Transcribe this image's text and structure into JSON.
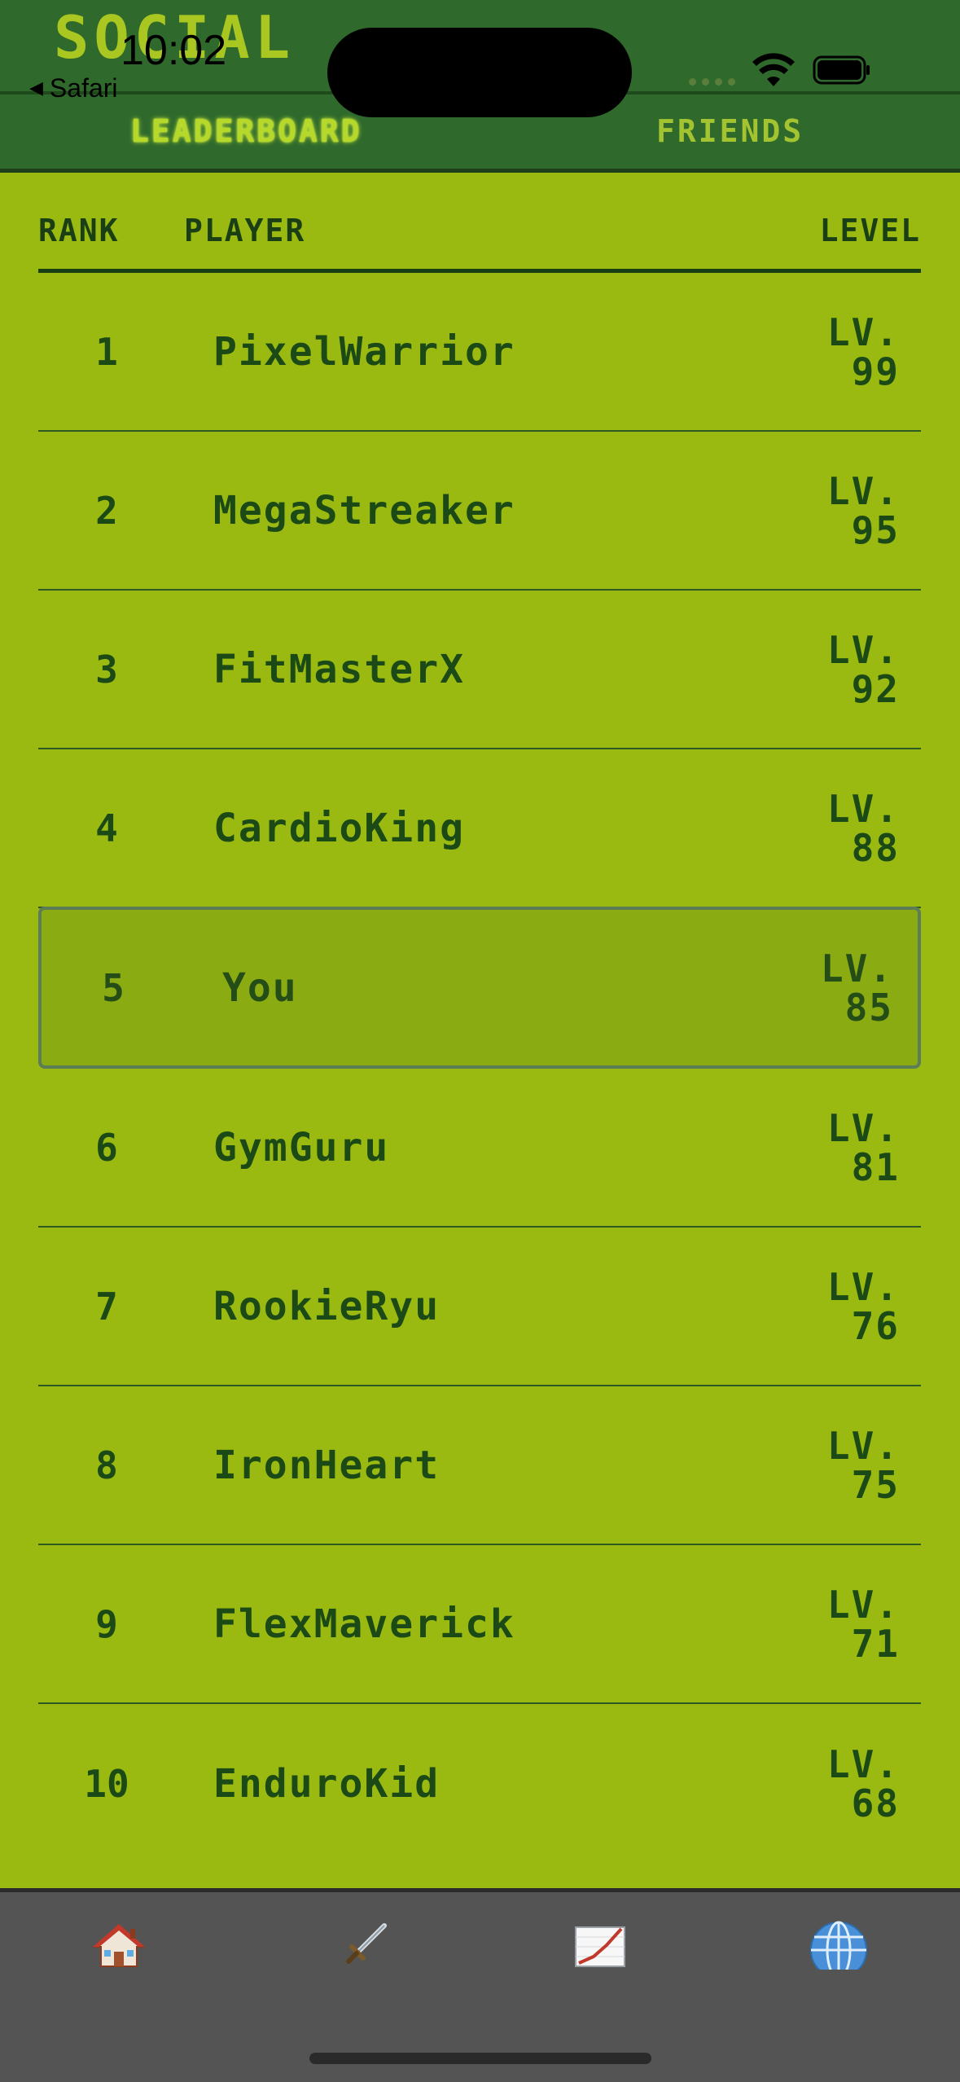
{
  "app": {
    "title": "SOCIAL"
  },
  "status_bar": {
    "time": "10:02",
    "back_label": "Safari"
  },
  "tabs": [
    {
      "label": "LEADERBOARD",
      "active": true
    },
    {
      "label": "FRIENDS",
      "active": false
    }
  ],
  "table": {
    "headers": {
      "rank": "RANK",
      "player": "PLAYER",
      "level": "LEVEL"
    },
    "level_prefix": "LV.",
    "rows": [
      {
        "rank": "1",
        "player": "PixelWarrior",
        "level": "99"
      },
      {
        "rank": "2",
        "player": "MegaStreaker",
        "level": "95"
      },
      {
        "rank": "3",
        "player": "FitMasterX",
        "level": "92"
      },
      {
        "rank": "4",
        "player": "CardioKing",
        "level": "88"
      },
      {
        "rank": "5",
        "player": "You",
        "level": "85",
        "highlight": true
      },
      {
        "rank": "6",
        "player": "GymGuru",
        "level": "81"
      },
      {
        "rank": "7",
        "player": "RookieRyu",
        "level": "76"
      },
      {
        "rank": "8",
        "player": "IronHeart",
        "level": "75"
      },
      {
        "rank": "9",
        "player": "FlexMaverick",
        "level": "71"
      },
      {
        "rank": "10",
        "player": "EnduroKid",
        "level": "68"
      }
    ]
  },
  "bottom_nav": [
    {
      "icon": "house-icon"
    },
    {
      "icon": "sword-icon"
    },
    {
      "icon": "chart-icon"
    },
    {
      "icon": "globe-icon"
    }
  ],
  "colors": {
    "background": "#9aba11",
    "header": "#2f6a2c",
    "text_dark_green": "#1c4a16",
    "highlight_row": "#8aab12",
    "nav_bar": "#545454"
  }
}
